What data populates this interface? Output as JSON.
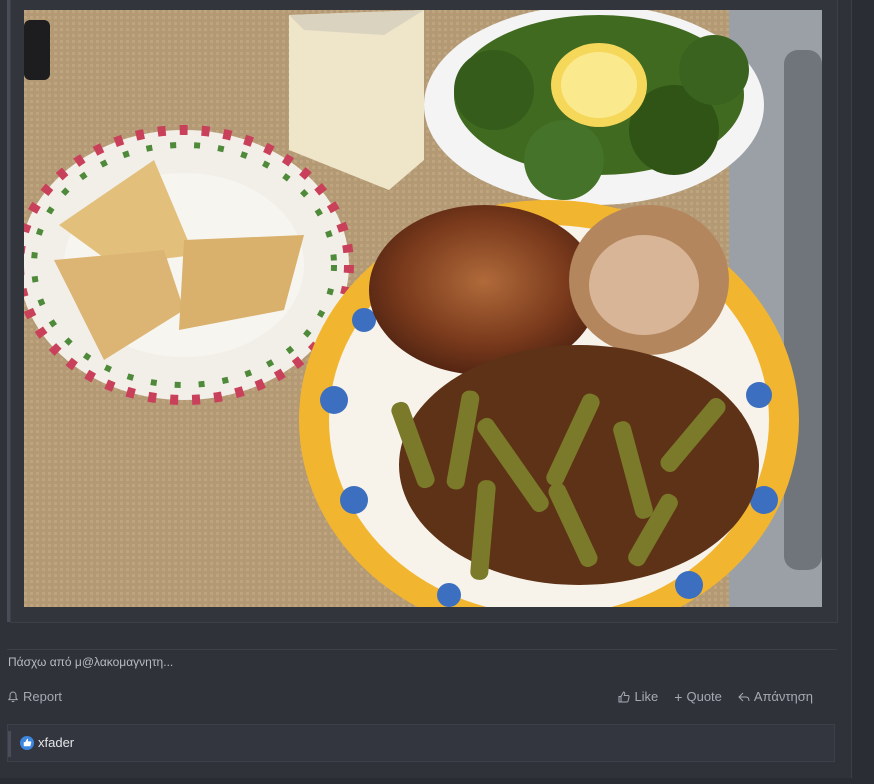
{
  "post": {
    "image_alt": "Food photo: roast chicken with okra, samosas, cheese, broccoli with lemon",
    "signature": "Πάσχω από μ@λακομαγνητη...",
    "report_label": "Report",
    "like_label": "Like",
    "quote_label": "Quote",
    "reply_label": "Απάντηση",
    "reactions": {
      "user": "xfader",
      "icon": "thumbs-up-icon"
    }
  },
  "colors": {
    "background": "#2b2d35",
    "post_bg": "#30323a",
    "like_badge": "#3d87e0"
  }
}
